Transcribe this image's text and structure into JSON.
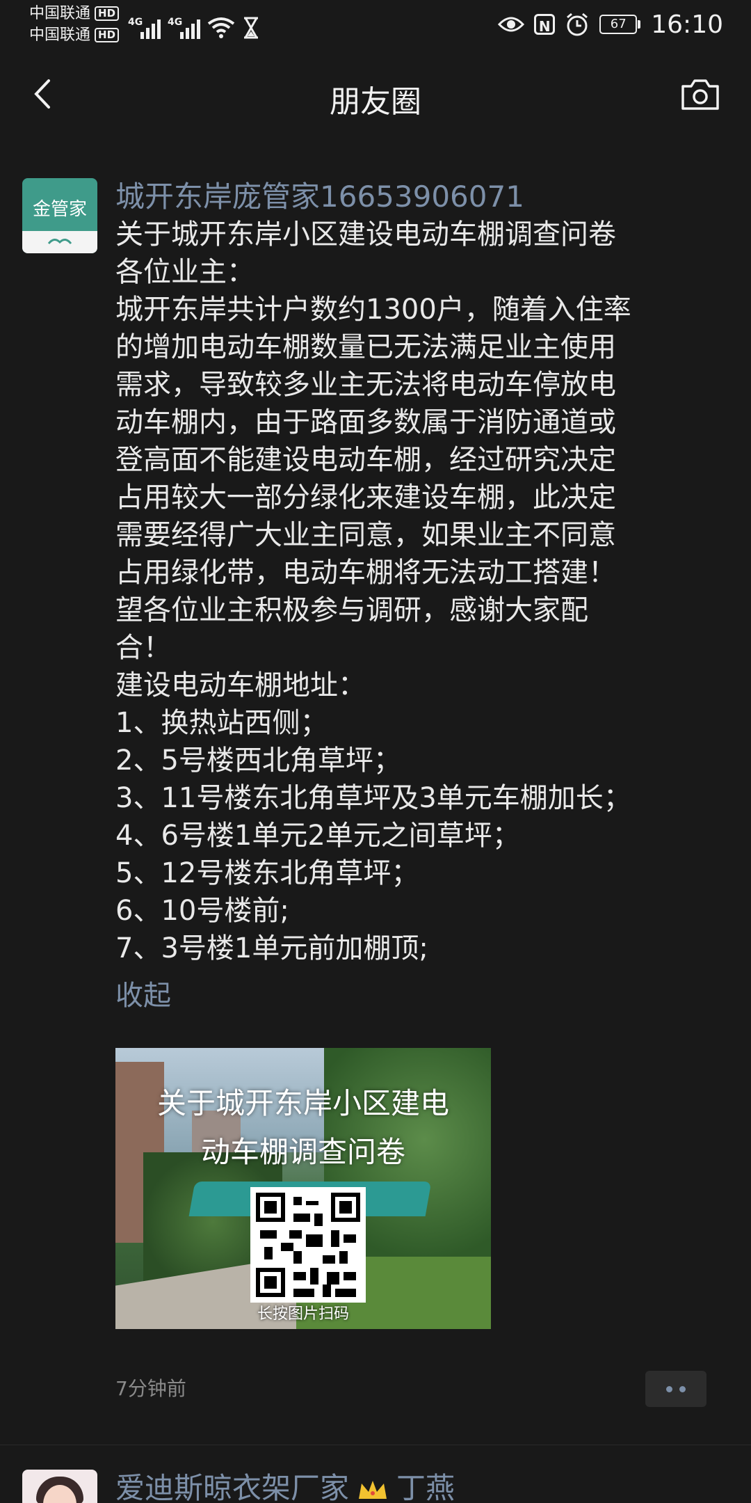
{
  "status_bar": {
    "carrier1": "中国联通",
    "carrier2": "中国联通",
    "hd_badge": "HD",
    "network_type": "4G",
    "battery_level": "67",
    "time": "16:10",
    "icons": [
      "signal-icon",
      "wifi-icon",
      "hourglass-icon",
      "eye-icon",
      "nfc-icon",
      "alarm-icon",
      "battery-icon"
    ]
  },
  "nav": {
    "title": "朋友圈",
    "back_icon": "back-arrow-icon",
    "camera_icon": "camera-icon"
  },
  "post": {
    "avatar_text": "金管家",
    "nickname": "城开东岸庞管家16653906071",
    "content_lines": [
      "关于城开东岸小区建设电动车棚调查问卷",
      "各位业主：",
      "城开东岸共计户数约1300户，随着入住率",
      "的增加电动车棚数量已无法满足业主使用",
      "需求，导致较多业主无法将电动车停放电",
      "动车棚内，由于路面多数属于消防通道或",
      "登高面不能建设电动车棚，经过研究决定",
      "占用较大一部分绿化来建设车棚，此决定",
      "需要经得广大业主同意，如果业主不同意",
      "占用绿化带，电动车棚将无法动工搭建！",
      "望各位业主积极参与调研，感谢大家配",
      "合！",
      "建设电动车棚地址：",
      "1、换热站西侧；",
      "2、5号楼西北角草坪；",
      "3、11号楼东北角草坪及3单元车棚加长；",
      "4、6号楼1单元2单元之间草坪；",
      "5、12号楼东北角草坪；",
      "6、10号楼前;",
      "7、3号楼1单元前加棚顶;"
    ],
    "collapse_label": "收起",
    "image": {
      "title_line1": "关于城开东岸小区建电",
      "title_line2": "动车棚调查问卷",
      "hint": "长按图片扫码"
    },
    "time_ago": "7分钟前"
  },
  "post2": {
    "nickname_part1": "爱迪斯晾衣架厂家",
    "nickname_part2": "丁燕"
  },
  "colors": {
    "background": "#191919",
    "nickname": "#7d90a9",
    "text": "#e9e9e9",
    "secondary": "#8a8a8a",
    "avatar_green": "#3f9b8a"
  }
}
